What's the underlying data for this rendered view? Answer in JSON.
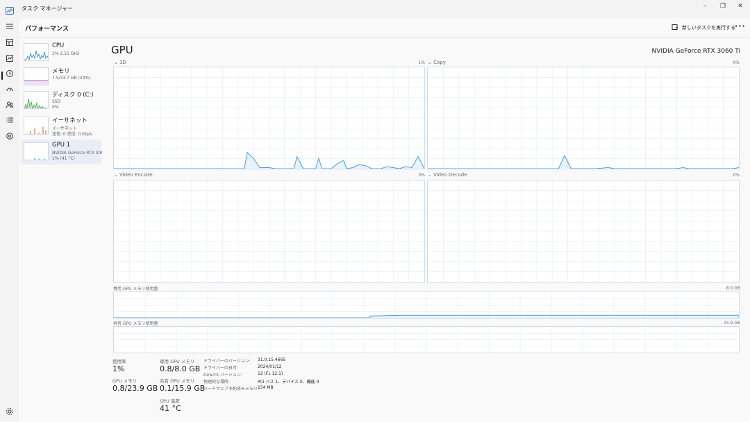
{
  "window": {
    "title": "タスク マネージャー",
    "minimize": "–",
    "maximize": "❐",
    "close": "✕"
  },
  "header": {
    "title": "パフォーマンス",
    "run_task_label": "新しいタスクを実行する",
    "more_label": "···"
  },
  "devices": [
    {
      "name": "CPU",
      "line1": "2% 2.11 GHz",
      "line2": ""
    },
    {
      "name": "メモリ",
      "line1": "7.5/31.7 GB (24%)",
      "line2": ""
    },
    {
      "name": "ディスク 0 (C:)",
      "line1": "SSD",
      "line2": "0%"
    },
    {
      "name": "イーサネット",
      "line1": "イーサネット",
      "line2": "送信: 0 受信: 0 Kbps"
    },
    {
      "name": "GPU 1",
      "line1": "NVIDIA GeForce RTX 306",
      "line2": "1% (41 °C)"
    }
  ],
  "main": {
    "title": "GPU",
    "model": "NVIDIA GeForce RTX 3060 Ti",
    "engines": [
      {
        "label": "3D",
        "value": "1%"
      },
      {
        "label": "Copy",
        "value": "0%"
      },
      {
        "label": "Video Encode",
        "value": "0%"
      },
      {
        "label": "Video Decode",
        "value": "0%"
      }
    ],
    "dedicated_mem_label": "専用 GPU メモリ使用量",
    "dedicated_mem_max": "8.0 GB",
    "shared_mem_label": "共有 GPU メモリ使用量",
    "shared_mem_max": "15.9 GB"
  },
  "stats": {
    "usage_label": "使用率",
    "usage_value": "1%",
    "gpu_mem_label": "GPU メモリ",
    "gpu_mem_value": "0.8/23.9 GB",
    "dedicated_label": "専用 GPU メモリ",
    "dedicated_value": "0.8/8.0 GB",
    "shared_label": "共有 GPU メモリ",
    "shared_value": "0.1/15.9 GB",
    "temp_label": "GPU 温度",
    "temp_value": "41 °C"
  },
  "info": [
    {
      "key": "ドライバーのバージョン:",
      "value": "31.0.15.4665"
    },
    {
      "key": "ドライバーの日付:",
      "value": "2024/01/12"
    },
    {
      "key": "DirectX バージョン:",
      "value": "12 (FL 12.1)"
    },
    {
      "key": "物理的な場所:",
      "value": "PCI バス 1、デバイス 0、機能 0"
    },
    {
      "key": "ハードウェア予約済みメモリ:",
      "value": "154 MB"
    }
  ],
  "icons": [
    "hamburger-icon",
    "processes-icon",
    "performance-icon",
    "history-icon",
    "startup-icon",
    "users-icon",
    "details-icon",
    "services-icon",
    "settings-icon"
  ],
  "colors": {
    "accent": "#1a7fd6",
    "gpu_line": "#4a9be0",
    "cpu_line": "#1a7fd6",
    "mem_line": "#8b3a9b",
    "disk_line": "#4fa64f",
    "net_line": "#b5652d"
  }
}
